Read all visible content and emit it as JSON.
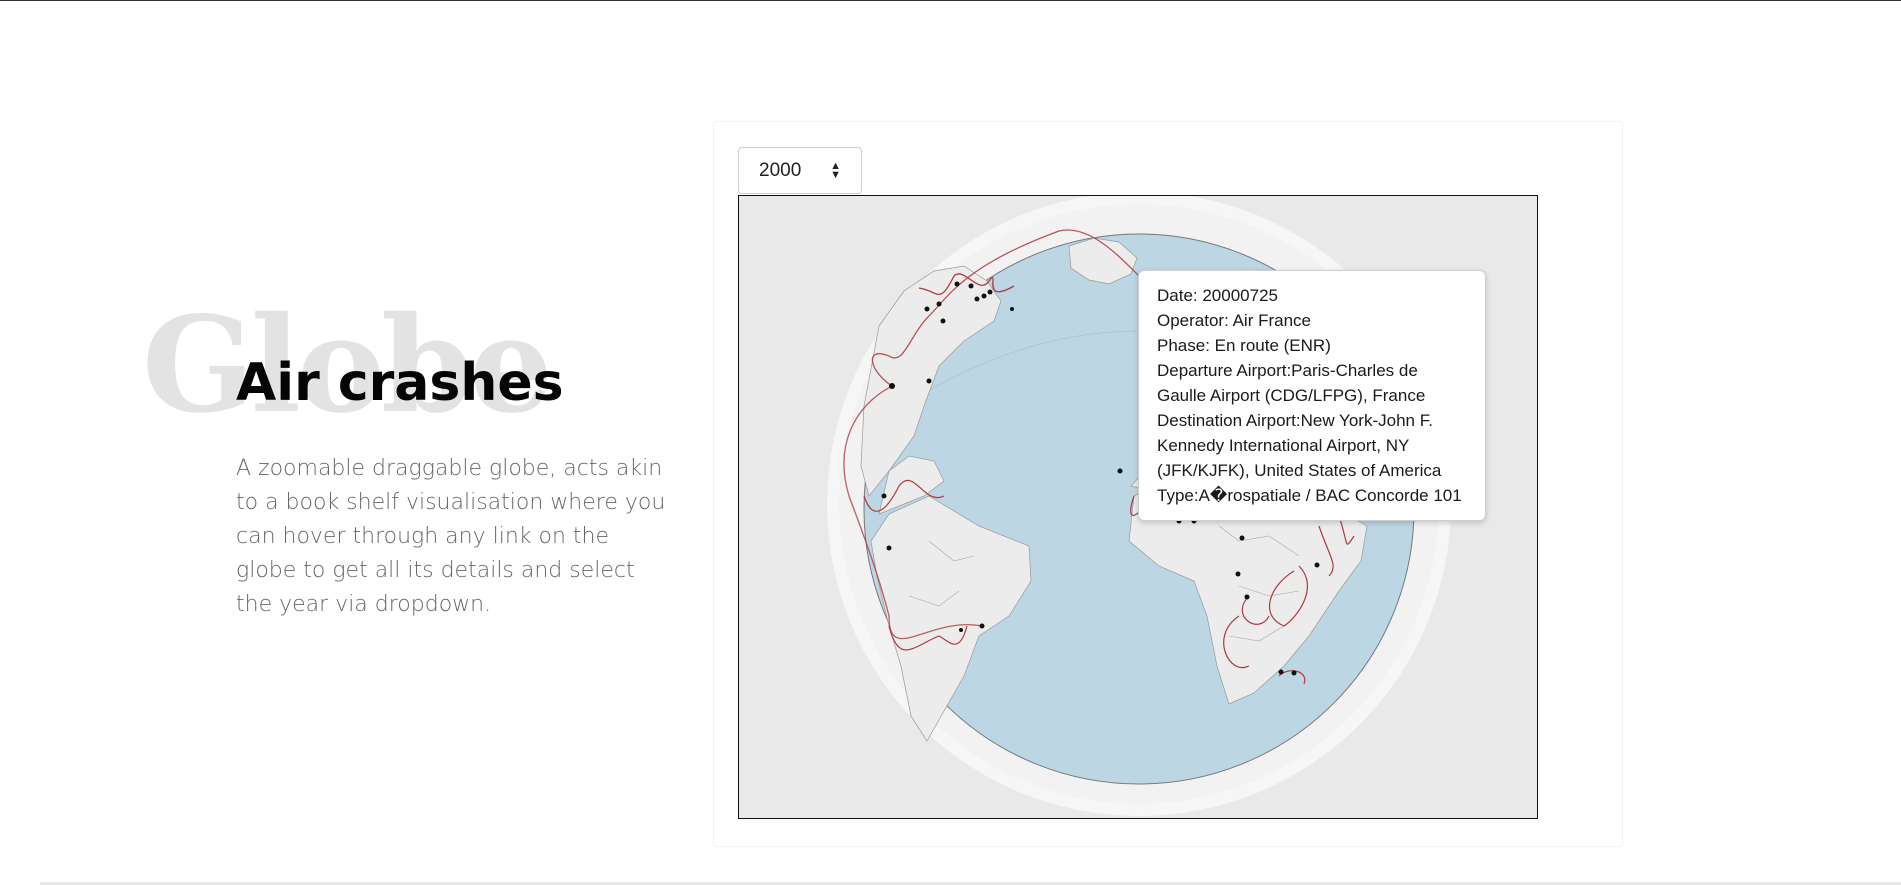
{
  "hero": {
    "background_word": "Globe",
    "title": "Air crashes",
    "description": "A zoomable draggable globe, acts akin to a book shelf visualisation where you can hover through any link on the globe to get all its details and select the year via dropdown."
  },
  "year_select": {
    "selected": "2000"
  },
  "tooltip": {
    "date": "Date: 20000725",
    "operator": "Operator: Air France",
    "phase": "Phase: En route (ENR)",
    "departure": "Departure Airport:Paris-Charles de Gaulle Airport (CDG/LFPG), France",
    "destination": "Destination Airport:New York-John F. Kennedy International Airport, NY (JFK/KJFK), United States of America",
    "type": "Type:A�rospatiale / BAC Concorde 101"
  },
  "colors": {
    "ocean": "#bcd6e4",
    "land": "#ececec",
    "route": "#b0393f",
    "crash_point": "#111111",
    "frame_bg": "#e9e9e9"
  },
  "icons": {
    "select_caret": "sort-arrows-icon",
    "crash_marker": "dot-icon"
  }
}
